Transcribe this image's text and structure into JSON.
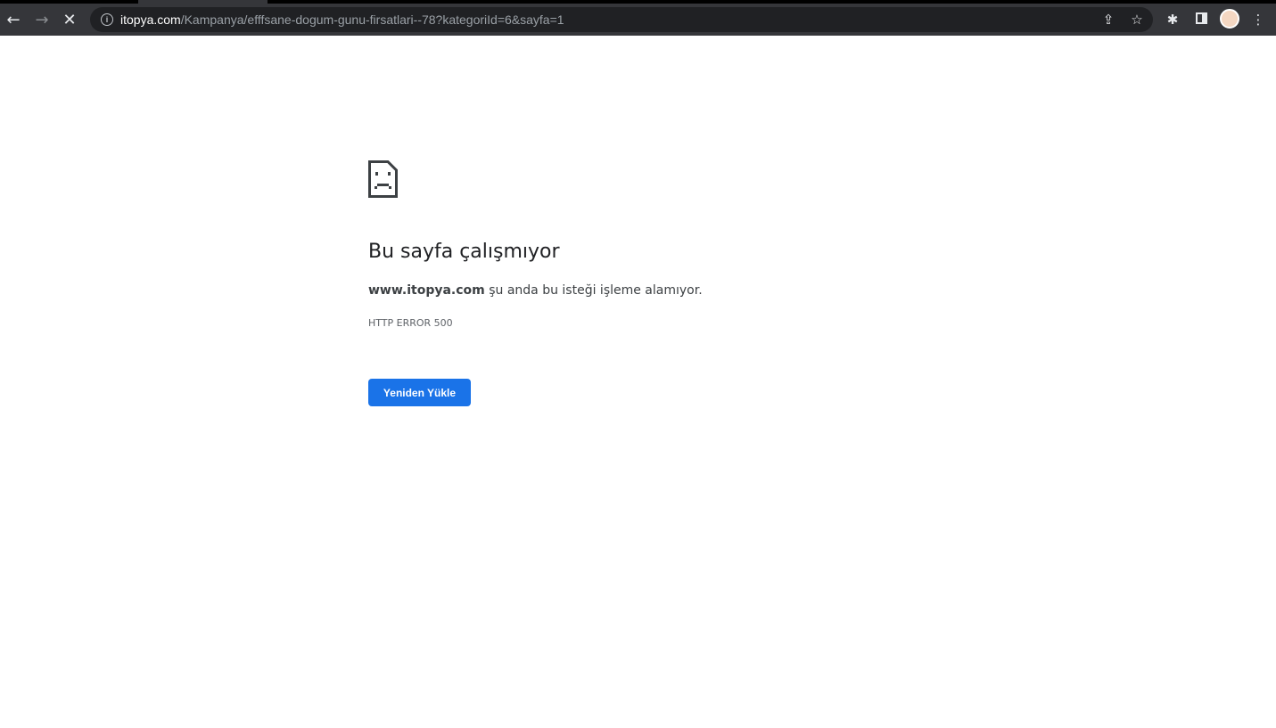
{
  "browser": {
    "url_host": "itopya.com",
    "url_path": "/Kampanya/efffsane-dogum-gunu-firsatlari--78?kategoriId=6&sayfa=1",
    "icons": [
      "back-icon",
      "forward-icon",
      "stop-icon",
      "info-icon",
      "share-icon",
      "star-icon",
      "extensions-icon",
      "side-panel-icon",
      "avatar",
      "menu-icon"
    ]
  },
  "error": {
    "title": "Bu sayfa çalışmıyor",
    "host": "www.itopya.com",
    "message": " şu anda bu isteği işleme alamıyor.",
    "code": "HTTP ERROR 500",
    "reload_label": "Yeniden Yükle"
  },
  "colors": {
    "button": "#1a73e8"
  }
}
